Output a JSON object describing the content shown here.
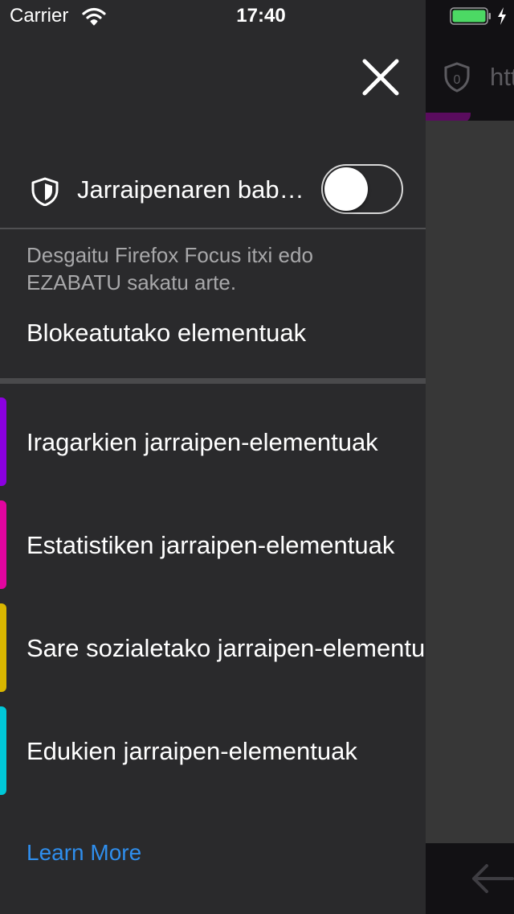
{
  "status_bar": {
    "carrier": "Carrier",
    "time": "17:40",
    "battery_color": "#4cd964"
  },
  "background_browser": {
    "url_text": "htt",
    "progress_color": "#5a0c5e"
  },
  "panel": {
    "close_icon": "close-icon",
    "tracking_protection": {
      "label": "Jarraipenaren babesa",
      "icon": "shield-icon",
      "enabled": false
    },
    "description": "Desgaitu Firefox Focus itxi edo EZABATU sakatu arte.",
    "blocked_heading": "Blokeatutako elementuak",
    "trackers": [
      {
        "label": "Iragarkien jarraipen-elementuak",
        "color": "#8b00e0"
      },
      {
        "label": "Estatistiken jarraipen-elementuak",
        "color": "#e2059f"
      },
      {
        "label": "Sare sozialetako jarraipen-elementuak",
        "color": "#d9b600"
      },
      {
        "label": "Edukien jarraipen-elementuak",
        "color": "#00c8d8"
      }
    ],
    "learn_more": "Learn More",
    "link_color": "#2f8eed"
  }
}
